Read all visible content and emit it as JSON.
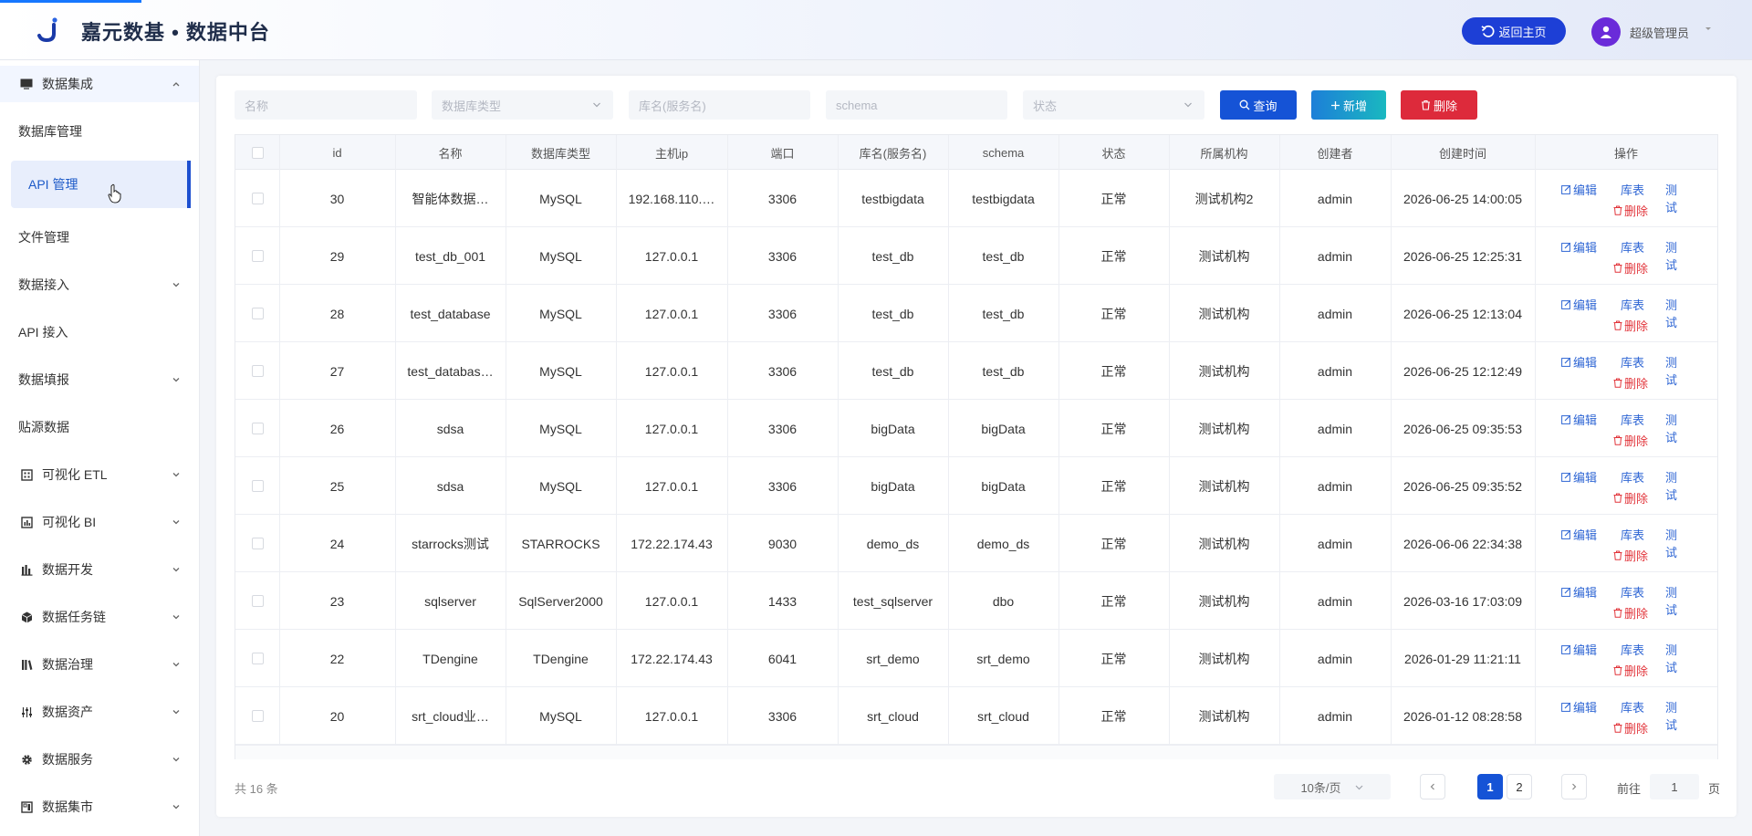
{
  "header": {
    "title": "嘉元数基 • 数据中台",
    "home_button": "返回主页",
    "user_name": "超级管理员",
    "colors": {
      "primary": "#1d3fd6",
      "avatar": "#6a2bd9"
    }
  },
  "sidebar": {
    "items": [
      {
        "label": "数据集成",
        "icon": "monitor-icon",
        "expanded": true
      },
      {
        "label": "数据库管理"
      },
      {
        "label": "API 管理",
        "active": true
      },
      {
        "label": "文件管理"
      },
      {
        "label": "数据接入",
        "has_children": true
      },
      {
        "label": "API 接入"
      },
      {
        "label": "数据填报",
        "has_children": true
      },
      {
        "label": "贴源数据"
      },
      {
        "label": "可视化 ETL",
        "icon": "building-icon",
        "has_children": true
      },
      {
        "label": "可视化 BI",
        "icon": "bar-chart-icon",
        "has_children": true
      },
      {
        "label": "数据开发",
        "icon": "bar-stats-icon",
        "has_children": true
      },
      {
        "label": "数据任务链",
        "icon": "cube-icon",
        "has_children": true
      },
      {
        "label": "数据治理",
        "icon": "books-icon",
        "has_children": true
      },
      {
        "label": "数据资产",
        "icon": "sliders-icon",
        "has_children": true
      },
      {
        "label": "数据服务",
        "icon": "gear-icon",
        "has_children": true
      },
      {
        "label": "数据集市",
        "icon": "store-icon",
        "has_children": true
      }
    ]
  },
  "filters": {
    "name_placeholder": "名称",
    "dbtype_placeholder": "数据库类型",
    "dbname_placeholder": "库名(服务名)",
    "schema_placeholder": "schema",
    "status_placeholder": "状态"
  },
  "buttons": {
    "query": "查询",
    "add": "新增",
    "delete": "删除",
    "colors": {
      "query": "#1553d6",
      "add": "#1aa8c7",
      "delete": "#dd2a3b"
    }
  },
  "table": {
    "columns": [
      "id",
      "名称",
      "数据库类型",
      "主机ip",
      "端口",
      "库名(服务名)",
      "schema",
      "状态",
      "所属机构",
      "创建者",
      "创建时间",
      "操作"
    ],
    "rows": [
      {
        "id": "30",
        "name": "智能体数据…",
        "type": "MySQL",
        "host": "192.168.110.…",
        "port": "3306",
        "db": "testbigdata",
        "schema": "testbigdata",
        "status": "正常",
        "org": "测试机构2",
        "creator": "admin",
        "created": "2026-06-25 14:00:05"
      },
      {
        "id": "29",
        "name": "test_db_001",
        "type": "MySQL",
        "host": "127.0.0.1",
        "port": "3306",
        "db": "test_db",
        "schema": "test_db",
        "status": "正常",
        "org": "测试机构",
        "creator": "admin",
        "created": "2026-06-25 12:25:31"
      },
      {
        "id": "28",
        "name": "test_database",
        "type": "MySQL",
        "host": "127.0.0.1",
        "port": "3306",
        "db": "test_db",
        "schema": "test_db",
        "status": "正常",
        "org": "测试机构",
        "creator": "admin",
        "created": "2026-06-25 12:13:04"
      },
      {
        "id": "27",
        "name": "test_databas…",
        "type": "MySQL",
        "host": "127.0.0.1",
        "port": "3306",
        "db": "test_db",
        "schema": "test_db",
        "status": "正常",
        "org": "测试机构",
        "creator": "admin",
        "created": "2026-06-25 12:12:49"
      },
      {
        "id": "26",
        "name": "sdsa",
        "type": "MySQL",
        "host": "127.0.0.1",
        "port": "3306",
        "db": "bigData",
        "schema": "bigData",
        "status": "正常",
        "org": "测试机构",
        "creator": "admin",
        "created": "2026-06-25 09:35:53"
      },
      {
        "id": "25",
        "name": "sdsa",
        "type": "MySQL",
        "host": "127.0.0.1",
        "port": "3306",
        "db": "bigData",
        "schema": "bigData",
        "status": "正常",
        "org": "测试机构",
        "creator": "admin",
        "created": "2026-06-25 09:35:52"
      },
      {
        "id": "24",
        "name": "starrocks测试",
        "type": "STARROCKS",
        "host": "172.22.174.43",
        "port": "9030",
        "db": "demo_ds",
        "schema": "demo_ds",
        "status": "正常",
        "org": "测试机构",
        "creator": "admin",
        "created": "2026-06-06 22:34:38"
      },
      {
        "id": "23",
        "name": "sqlserver",
        "type": "SqlServer2000",
        "host": "127.0.0.1",
        "port": "1433",
        "db": "test_sqlserver",
        "schema": "dbo",
        "status": "正常",
        "org": "测试机构",
        "creator": "admin",
        "created": "2026-03-16 17:03:09"
      },
      {
        "id": "22",
        "name": "TDengine",
        "type": "TDengine",
        "host": "172.22.174.43",
        "port": "6041",
        "db": "srt_demo",
        "schema": "srt_demo",
        "status": "正常",
        "org": "测试机构",
        "creator": "admin",
        "created": "2026-01-29 11:21:11"
      },
      {
        "id": "20",
        "name": "srt_cloud业…",
        "type": "MySQL",
        "host": "127.0.0.1",
        "port": "3306",
        "db": "srt_cloud",
        "schema": "srt_cloud",
        "status": "正常",
        "org": "测试机构",
        "creator": "admin",
        "created": "2026-01-12 08:28:58"
      }
    ],
    "actions": {
      "edit": "编辑",
      "tables": "库表",
      "test": "测试",
      "delete": "删除"
    }
  },
  "pagination": {
    "total": "共 16 条",
    "page_size": "10条/页",
    "pages": [
      "1",
      "2"
    ],
    "current": "1",
    "goto_label": "前往",
    "goto_value": "1",
    "page_suffix": "页"
  }
}
